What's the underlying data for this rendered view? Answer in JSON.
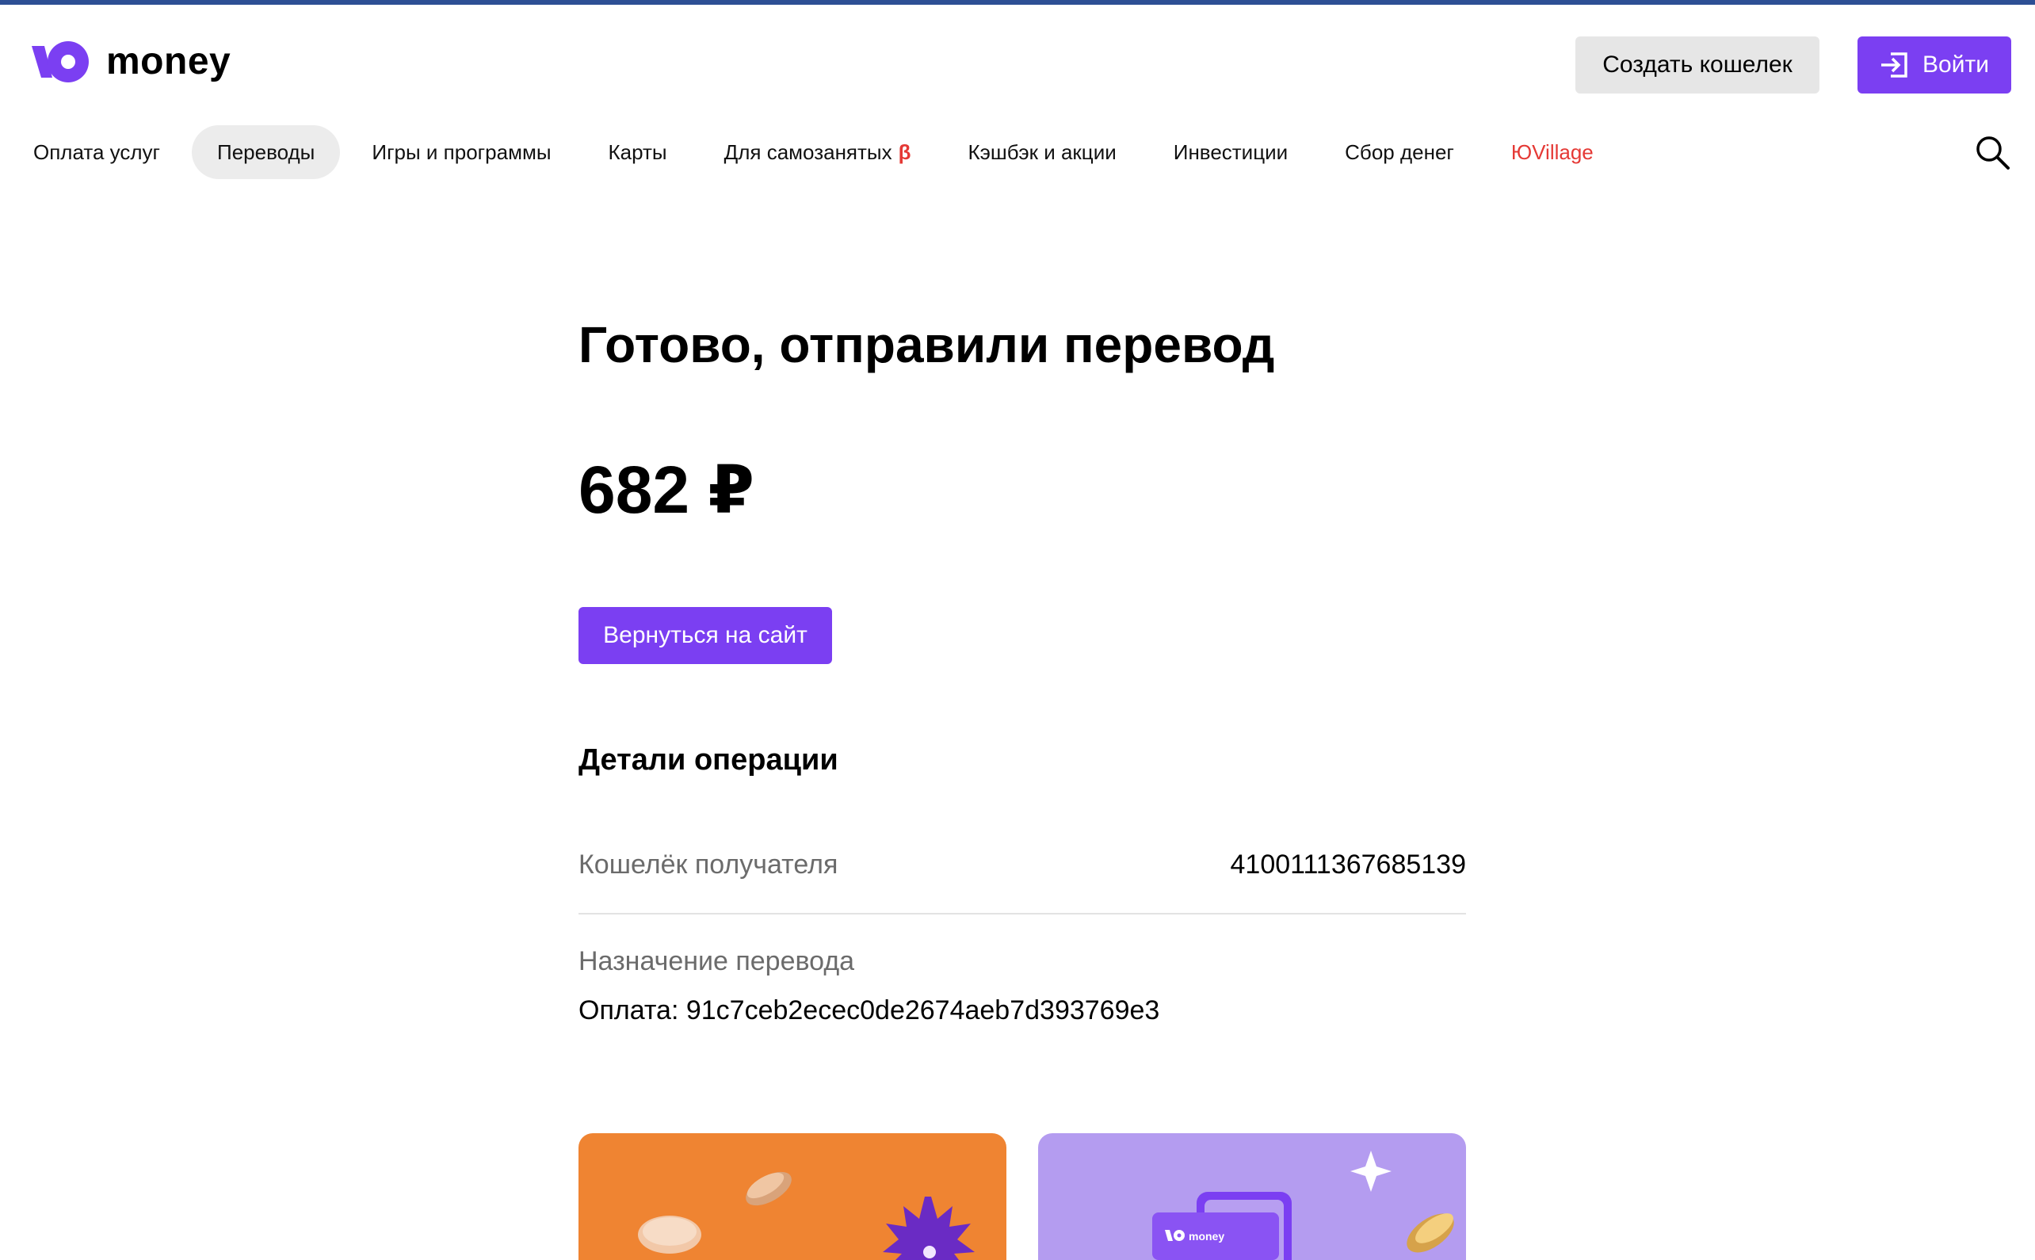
{
  "brand": {
    "name": "money",
    "accent_color": "#7b3ff2"
  },
  "header": {
    "create_wallet_label": "Создать кошелек",
    "login_label": "Войти"
  },
  "nav": {
    "items": [
      {
        "label": "Оплата услуг"
      },
      {
        "label": "Переводы",
        "active": true
      },
      {
        "label": "Игры и программы"
      },
      {
        "label": "Карты"
      },
      {
        "label": "Для самозанятых",
        "badge": "β"
      },
      {
        "label": "Кэшбэк и акции"
      },
      {
        "label": "Инвестиции"
      },
      {
        "label": "Сбор денег"
      },
      {
        "label": "ЮVillage",
        "color": "#e53935"
      }
    ],
    "search_icon": "search-icon"
  },
  "main": {
    "title": "Готово, отправили перевод",
    "amount": "682 ₽",
    "back_button_label": "Вернуться на сайт",
    "details_title": "Детали операции",
    "recipient_wallet_label": "Кошелёк получателя",
    "recipient_wallet_value": "4100111367685139",
    "purpose_label": "Назначение перевода",
    "purpose_value": "Оплата: 91c7ceb2ecec0de2674aeb7d393769e3"
  },
  "promo_cards": {
    "card2_brand": "money",
    "colors": [
      "#ef8432",
      "#b49cf0"
    ]
  }
}
